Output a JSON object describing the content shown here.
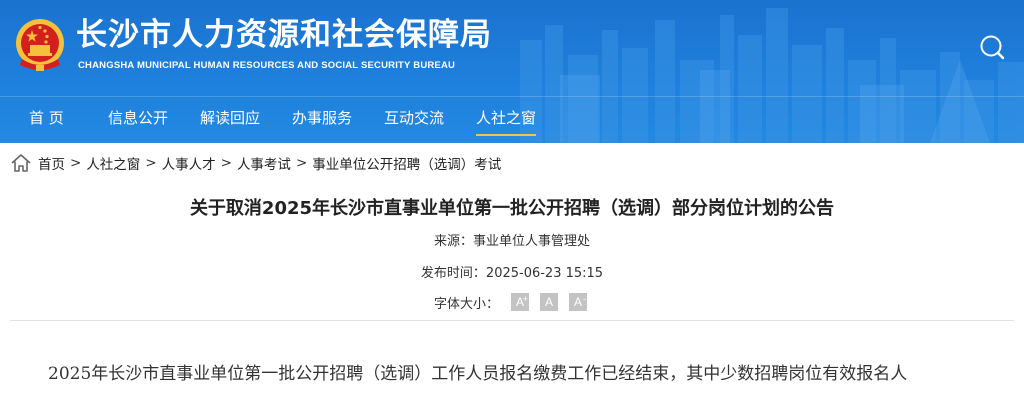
{
  "site": {
    "title": "长沙市人力资源和社会保障局",
    "subtitle": "CHANGSHA MUNICIPAL HUMAN RESOURCES AND SOCIAL SECURITY BUREAU",
    "brand_color": "#1e80dc",
    "search_icon": "search-icon"
  },
  "nav": {
    "items": [
      {
        "label": "首 页"
      },
      {
        "label": "信息公开"
      },
      {
        "label": "解读回应"
      },
      {
        "label": "办事服务"
      },
      {
        "label": "互动交流"
      },
      {
        "label": "人社之窗",
        "active": true
      }
    ],
    "active_color": "#f4c542"
  },
  "breadcrumb": {
    "icon": "home-icon",
    "items": [
      "首页",
      "人社之窗",
      "人事人才",
      "人事考试",
      "事业单位公开招聘（选调）考试"
    ],
    "separator": ">"
  },
  "article": {
    "title": "关于取消2025年长沙市直事业单位第一批公开招聘（选调）部分岗位计划的公告",
    "source_label": "来源：",
    "source": "事业单位人事管理处",
    "time_label": "发布时间：",
    "time": "2025-06-23 15:15",
    "font_size_label": "字体大小：",
    "font_size_options": [
      "A",
      "A",
      "A"
    ],
    "body_first_line": "2025年长沙市直事业单位第一批公开招聘（选调）工作人员报名缴费工作已经结束，其中少数招聘岗位有效报名人"
  }
}
